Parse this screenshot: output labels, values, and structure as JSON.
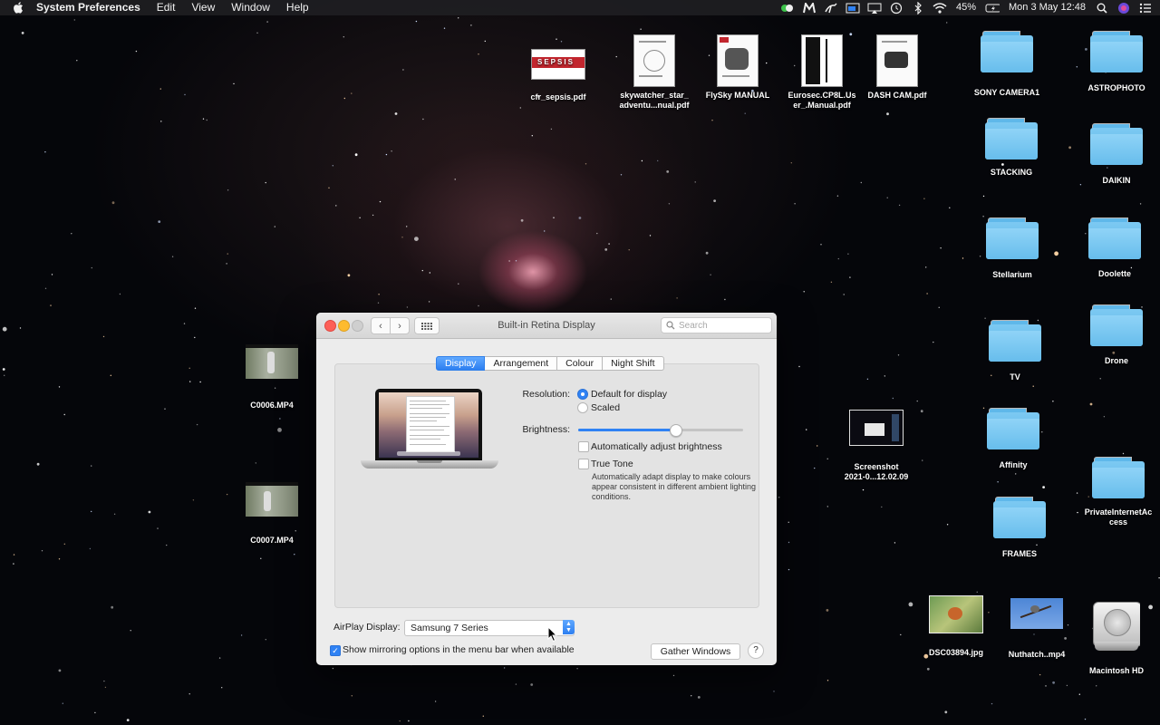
{
  "menubar": {
    "app_name": "System Preferences",
    "menus": [
      "Edit",
      "View",
      "Window",
      "Help"
    ],
    "battery": "45%",
    "clock": "Mon 3 May  12:48",
    "status_icons": [
      "bartender-icon",
      "malwarebytes-icon",
      "kangaroo-icon",
      "pip-icon",
      "airplay-icon",
      "time-machine-icon",
      "bluetooth-icon",
      "wifi-icon",
      "battery-icon",
      "search-icon",
      "siri-icon",
      "notification-center-icon"
    ]
  },
  "desktop": {
    "files": [
      {
        "label": "cfr_sepsis.pdf",
        "kind": "pdf"
      },
      {
        "label": "skywatcher_star_\nadventu...nual.pdf",
        "kind": "pdf"
      },
      {
        "label": "FlySky MANUAL",
        "kind": "pdf"
      },
      {
        "label": "Eurosec.CP8L.Us\ner_.Manual.pdf",
        "kind": "pdf"
      },
      {
        "label": "DASH CAM.pdf",
        "kind": "pdf"
      },
      {
        "label": "C0006.MP4",
        "kind": "video"
      },
      {
        "label": "C0007.MP4",
        "kind": "video"
      },
      {
        "label": "Screenshot\n2021-0...12.02.09",
        "kind": "image"
      },
      {
        "label": "DSC03894.jpg",
        "kind": "image"
      },
      {
        "label": "Nuthatch..mp4",
        "kind": "video"
      },
      {
        "label": "Macintosh HD",
        "kind": "disk"
      }
    ],
    "folders": [
      "SONY CAMERA1",
      "ASTROPHOTO",
      "STACKING",
      "DAIKIN",
      "Stellarium",
      "Doolette",
      "TV",
      "Drone",
      "Affinity",
      "PrivateInternetAc\ncess",
      "FRAMES"
    ],
    "folder_color": "#6cc1ef"
  },
  "window": {
    "title": "Built-in Retina Display",
    "search_placeholder": "Search",
    "tabs": [
      {
        "label": "Display",
        "active": true
      },
      {
        "label": "Arrangement",
        "active": false
      },
      {
        "label": "Colour",
        "active": false
      },
      {
        "label": "Night Shift",
        "active": false
      }
    ],
    "resolution_label": "Resolution:",
    "resolution_options": [
      {
        "label": "Default for display",
        "selected": true
      },
      {
        "label": "Scaled",
        "selected": false
      }
    ],
    "brightness_label": "Brightness:",
    "brightness_value": 0.59,
    "auto_brightness_label": "Automatically adjust brightness",
    "auto_brightness_checked": false,
    "true_tone_label": "True Tone",
    "true_tone_checked": false,
    "true_tone_description": "Automatically adapt display to make colours appear consistent in different ambient lighting conditions.",
    "airplay_label": "AirPlay Display:",
    "airplay_value": "Samsung 7 Series",
    "mirroring_label": "Show mirroring options in the menu bar when available",
    "mirroring_checked": true,
    "gather_label": "Gather Windows",
    "help_label": "?",
    "accent_color": "#2f82f4"
  }
}
